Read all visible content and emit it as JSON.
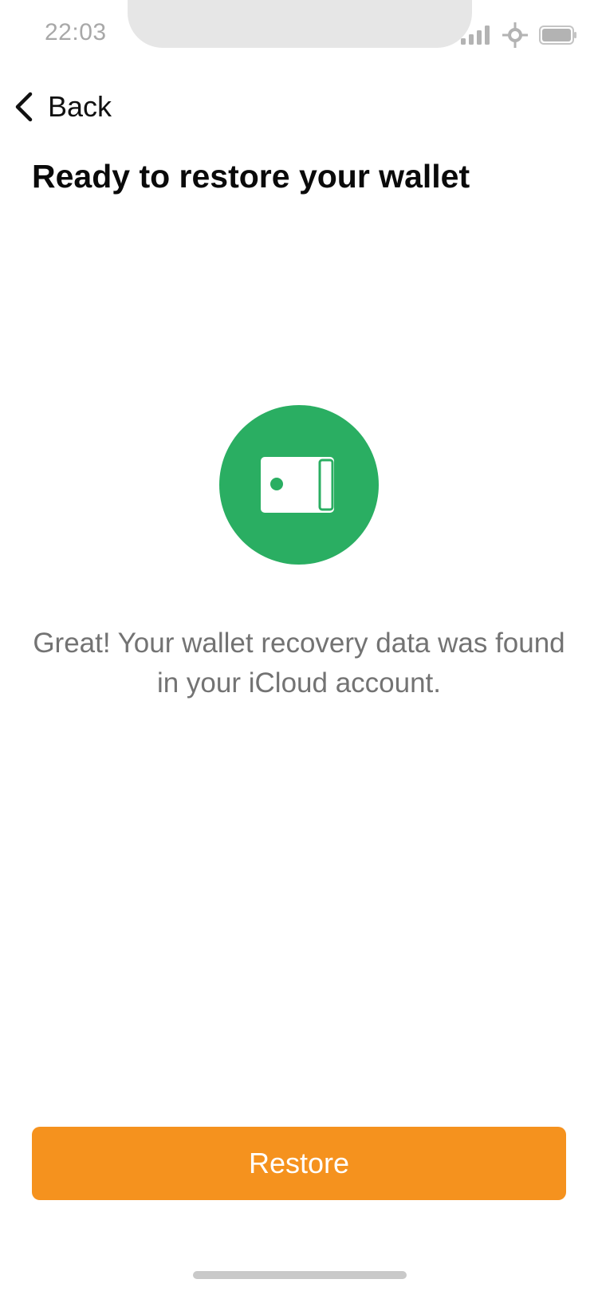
{
  "status_bar": {
    "time": "22:03",
    "icons": [
      "signal-icon",
      "location-icon",
      "battery-icon"
    ]
  },
  "nav": {
    "back_label": "Back",
    "back_icon": "chevron-left-icon"
  },
  "page": {
    "title": "Ready to restore your wallet",
    "badge_icon": "wallet-icon",
    "badge_color": "#2aae62",
    "message": "Great! Your wallet recovery data was found in your iCloud account."
  },
  "actions": {
    "restore_label": "Restore",
    "restore_color": "#f5921e"
  }
}
